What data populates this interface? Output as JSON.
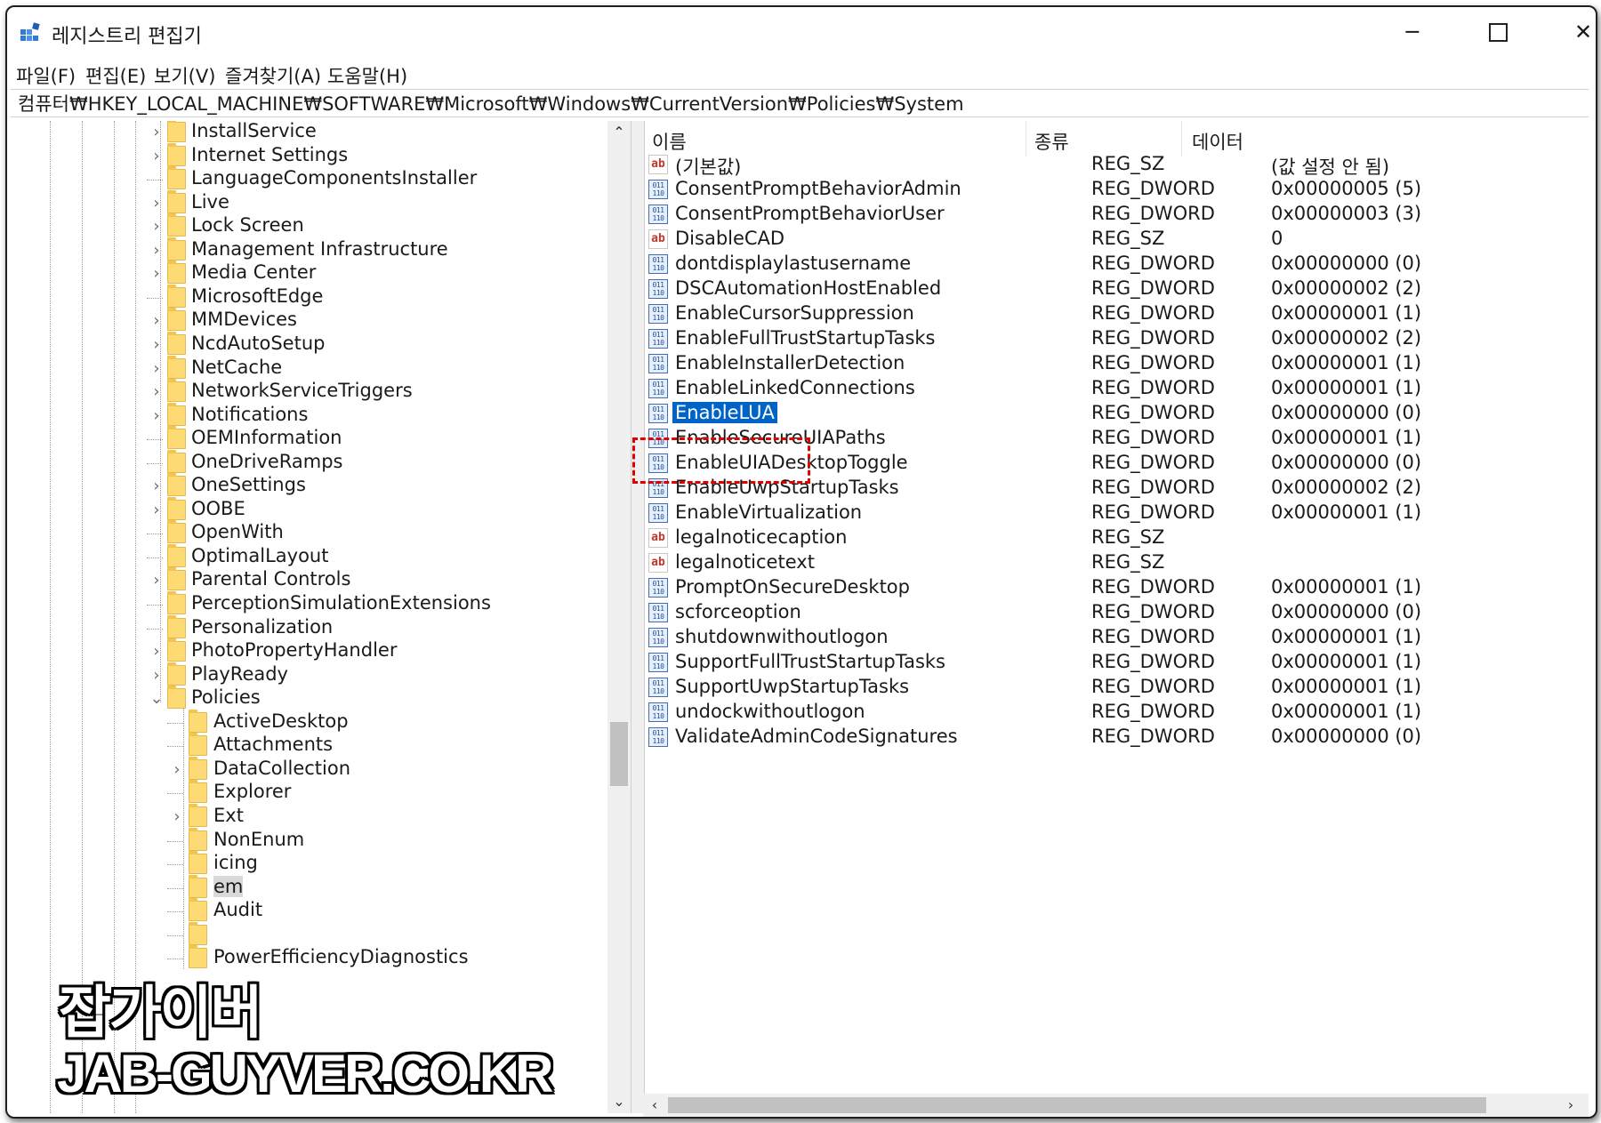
{
  "window": {
    "title": "레지스트리 편집기",
    "minimize": "─",
    "close": "✕"
  },
  "menu": [
    {
      "label": "파일(F)"
    },
    {
      "label": "편집(E)"
    },
    {
      "label": "보기(V)"
    },
    {
      "label": "즐겨찾기(A)"
    },
    {
      "label": "도움말(H)"
    }
  ],
  "address": "컴퓨터₩HKEY_LOCAL_MACHINE₩SOFTWARE₩Microsoft₩Windows₩CurrentVersion₩Policies₩System",
  "tree": {
    "items": [
      {
        "label": "InstallService",
        "expander": "›"
      },
      {
        "label": "Internet Settings",
        "expander": "›"
      },
      {
        "label": "LanguageComponentsInstaller",
        "expander": ""
      },
      {
        "label": "Live",
        "expander": "›"
      },
      {
        "label": "Lock Screen",
        "expander": "›"
      },
      {
        "label": "Management Infrastructure",
        "expander": "›"
      },
      {
        "label": "Media Center",
        "expander": "›"
      },
      {
        "label": "MicrosoftEdge",
        "expander": ""
      },
      {
        "label": "MMDevices",
        "expander": "›"
      },
      {
        "label": "NcdAutoSetup",
        "expander": "›"
      },
      {
        "label": "NetCache",
        "expander": "›"
      },
      {
        "label": "NetworkServiceTriggers",
        "expander": "›"
      },
      {
        "label": "Notifications",
        "expander": "›"
      },
      {
        "label": "OEMInformation",
        "expander": ""
      },
      {
        "label": "OneDriveRamps",
        "expander": ""
      },
      {
        "label": "OneSettings",
        "expander": "›"
      },
      {
        "label": "OOBE",
        "expander": "›"
      },
      {
        "label": "OpenWith",
        "expander": ""
      },
      {
        "label": "OptimalLayout",
        "expander": ""
      },
      {
        "label": "Parental Controls",
        "expander": "›"
      },
      {
        "label": "PerceptionSimulationExtensions",
        "expander": ""
      },
      {
        "label": "Personalization",
        "expander": ""
      },
      {
        "label": "PhotoPropertyHandler",
        "expander": "›"
      },
      {
        "label": "PlayReady",
        "expander": "›"
      },
      {
        "label": "Policies",
        "expander": "⌄"
      },
      {
        "label": "ActiveDesktop",
        "expander": ""
      },
      {
        "label": "Attachments",
        "expander": ""
      },
      {
        "label": "DataCollection",
        "expander": "›"
      },
      {
        "label": "Explorer",
        "expander": ""
      },
      {
        "label": "Ext",
        "expander": "›"
      },
      {
        "label": "NonEnum",
        "expander": ""
      },
      {
        "label": "icing",
        "expander": ""
      },
      {
        "label": "em",
        "expander": ""
      },
      {
        "label": "Audit",
        "expander": ""
      },
      {
        "label": "",
        "expander": ""
      },
      {
        "label": "PowerEfficiencyDiagnostics",
        "expander": ""
      }
    ]
  },
  "scroll": {
    "up": "⌃",
    "down": "⌄",
    "left": "‹",
    "right": "›"
  },
  "list": {
    "columns": {
      "name": "이름",
      "type": "종류",
      "data": "데이터"
    },
    "rows": [
      {
        "icon": "ab",
        "name": "(기본값)",
        "type": "REG_SZ",
        "data": "(값 설정 안 됨)"
      },
      {
        "icon": "dword",
        "name": "ConsentPromptBehaviorAdmin",
        "type": "REG_DWORD",
        "data": "0x00000005 (5)"
      },
      {
        "icon": "dword",
        "name": "ConsentPromptBehaviorUser",
        "type": "REG_DWORD",
        "data": "0x00000003 (3)"
      },
      {
        "icon": "ab",
        "name": "DisableCAD",
        "type": "REG_SZ",
        "data": "0"
      },
      {
        "icon": "dword",
        "name": "dontdisplaylastusername",
        "type": "REG_DWORD",
        "data": "0x00000000 (0)"
      },
      {
        "icon": "dword",
        "name": "DSCAutomationHostEnabled",
        "type": "REG_DWORD",
        "data": "0x00000002 (2)"
      },
      {
        "icon": "dword",
        "name": "EnableCursorSuppression",
        "type": "REG_DWORD",
        "data": "0x00000001 (1)"
      },
      {
        "icon": "dword",
        "name": "EnableFullTrustStartupTasks",
        "type": "REG_DWORD",
        "data": "0x00000002 (2)"
      },
      {
        "icon": "dword",
        "name": "EnableInstallerDetection",
        "type": "REG_DWORD",
        "data": "0x00000001 (1)"
      },
      {
        "icon": "dword",
        "name": "EnableLinkedConnections",
        "type": "REG_DWORD",
        "data": "0x00000001 (1)"
      },
      {
        "icon": "dword",
        "name": "EnableLUA",
        "type": "REG_DWORD",
        "data": "0x00000000 (0)",
        "selected": true
      },
      {
        "icon": "dword",
        "name": "EnableSecureUIAPaths",
        "type": "REG_DWORD",
        "data": "0x00000001 (1)"
      },
      {
        "icon": "dword",
        "name": "EnableUIADesktopToggle",
        "type": "REG_DWORD",
        "data": "0x00000000 (0)"
      },
      {
        "icon": "dword",
        "name": "EnableUwpStartupTasks",
        "type": "REG_DWORD",
        "data": "0x00000002 (2)"
      },
      {
        "icon": "dword",
        "name": "EnableVirtualization",
        "type": "REG_DWORD",
        "data": "0x00000001 (1)"
      },
      {
        "icon": "ab",
        "name": "legalnoticecaption",
        "type": "REG_SZ",
        "data": ""
      },
      {
        "icon": "ab",
        "name": "legalnoticetext",
        "type": "REG_SZ",
        "data": ""
      },
      {
        "icon": "dword",
        "name": "PromptOnSecureDesktop",
        "type": "REG_DWORD",
        "data": "0x00000001 (1)"
      },
      {
        "icon": "dword",
        "name": "scforceoption",
        "type": "REG_DWORD",
        "data": "0x00000000 (0)"
      },
      {
        "icon": "dword",
        "name": "shutdownwithoutlogon",
        "type": "REG_DWORD",
        "data": "0x00000001 (1)"
      },
      {
        "icon": "dword",
        "name": "SupportFullTrustStartupTasks",
        "type": "REG_DWORD",
        "data": "0x00000001 (1)"
      },
      {
        "icon": "dword",
        "name": "SupportUwpStartupTasks",
        "type": "REG_DWORD",
        "data": "0x00000001 (1)"
      },
      {
        "icon": "dword",
        "name": "undockwithoutlogon",
        "type": "REG_DWORD",
        "data": "0x00000001 (1)"
      },
      {
        "icon": "dword",
        "name": "ValidateAdminCodeSignatures",
        "type": "REG_DWORD",
        "data": "0x00000000 (0)"
      }
    ]
  },
  "watermark": {
    "korean": "잡가이버",
    "url": "JAB-GUYVER.CO.KR"
  },
  "colors": {
    "selection": "#0063c8",
    "highlight_border": "#e00000",
    "folder": "#fdda73"
  }
}
